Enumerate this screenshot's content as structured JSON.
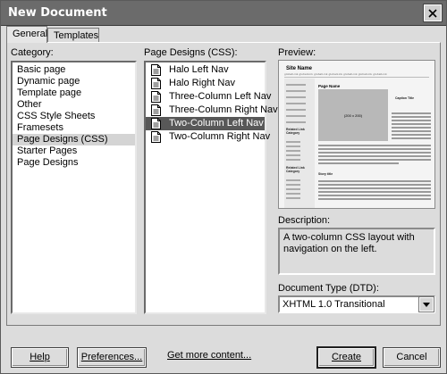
{
  "window": {
    "title": "New Document",
    "close_icon": "close-icon"
  },
  "tabs": [
    {
      "label": "General",
      "active": true
    },
    {
      "label": "Templates",
      "active": false
    }
  ],
  "category": {
    "label": "Category:",
    "items": [
      {
        "label": "Basic page",
        "selected": false
      },
      {
        "label": "Dynamic page",
        "selected": false
      },
      {
        "label": "Template page",
        "selected": false
      },
      {
        "label": "Other",
        "selected": false
      },
      {
        "label": "CSS Style Sheets",
        "selected": false
      },
      {
        "label": "Framesets",
        "selected": false
      },
      {
        "label": "Page Designs (CSS)",
        "selected": true
      },
      {
        "label": "Starter Pages",
        "selected": false
      },
      {
        "label": "Page Designs",
        "selected": false
      }
    ]
  },
  "designs": {
    "label": "Page Designs (CSS):",
    "items": [
      {
        "label": "Halo Left Nav",
        "selected": false,
        "icon": "document-icon"
      },
      {
        "label": "Halo Right Nav",
        "selected": false,
        "icon": "document-icon"
      },
      {
        "label": "Three-Column Left Nav",
        "selected": false,
        "icon": "document-icon"
      },
      {
        "label": "Three-Column Right Nav",
        "selected": false,
        "icon": "document-icon"
      },
      {
        "label": "Two-Column Left Nav",
        "selected": true,
        "icon": "document-icon"
      },
      {
        "label": "Two-Column Right Nav",
        "selected": false,
        "icon": "document-icon"
      }
    ]
  },
  "preview": {
    "label": "Preview:",
    "site_name": "Site Name",
    "nav_text": "globalLink globalLink globalLink globalLink globalLink globalLink globalLink",
    "page_name": "Page Name",
    "image_label": "(200 x 200)",
    "caption": "Caption Title",
    "sidebar_heading_1": "Related Link Category",
    "sidebar_heading_2": "Related Link Category",
    "story_title": "Story title"
  },
  "description": {
    "label": "Description:",
    "text": "A two-column CSS layout with navigation on the left."
  },
  "doctype": {
    "label": "Document Type (DTD):",
    "value": "XHTML 1.0 Transitional"
  },
  "buttons": {
    "help": "Help",
    "preferences": "Preferences...",
    "get_more": "Get more content...",
    "create": "Create",
    "cancel": "Cancel"
  }
}
